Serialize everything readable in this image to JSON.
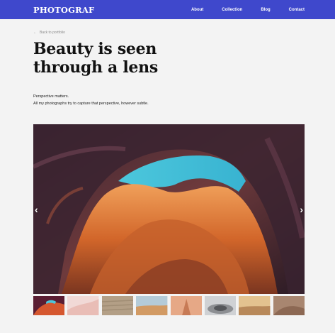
{
  "brand": {
    "logo": "PHOTOGRAF",
    "accent": "#3f48cc"
  },
  "nav": {
    "items": [
      "About",
      "Collection",
      "Blog",
      "Contact"
    ]
  },
  "back_link": {
    "arrow": "←",
    "label": "Back to portfolio"
  },
  "title": {
    "line1": "Beauty is seen",
    "line2": "through a lens"
  },
  "description": {
    "line1": "Perspective matters.",
    "line2": "All my photographs try to capture that perspective, however subtle."
  },
  "carousel": {
    "prev_icon": "‹",
    "next_icon": "›",
    "active_index": 0,
    "thumbnail_count": 8
  }
}
